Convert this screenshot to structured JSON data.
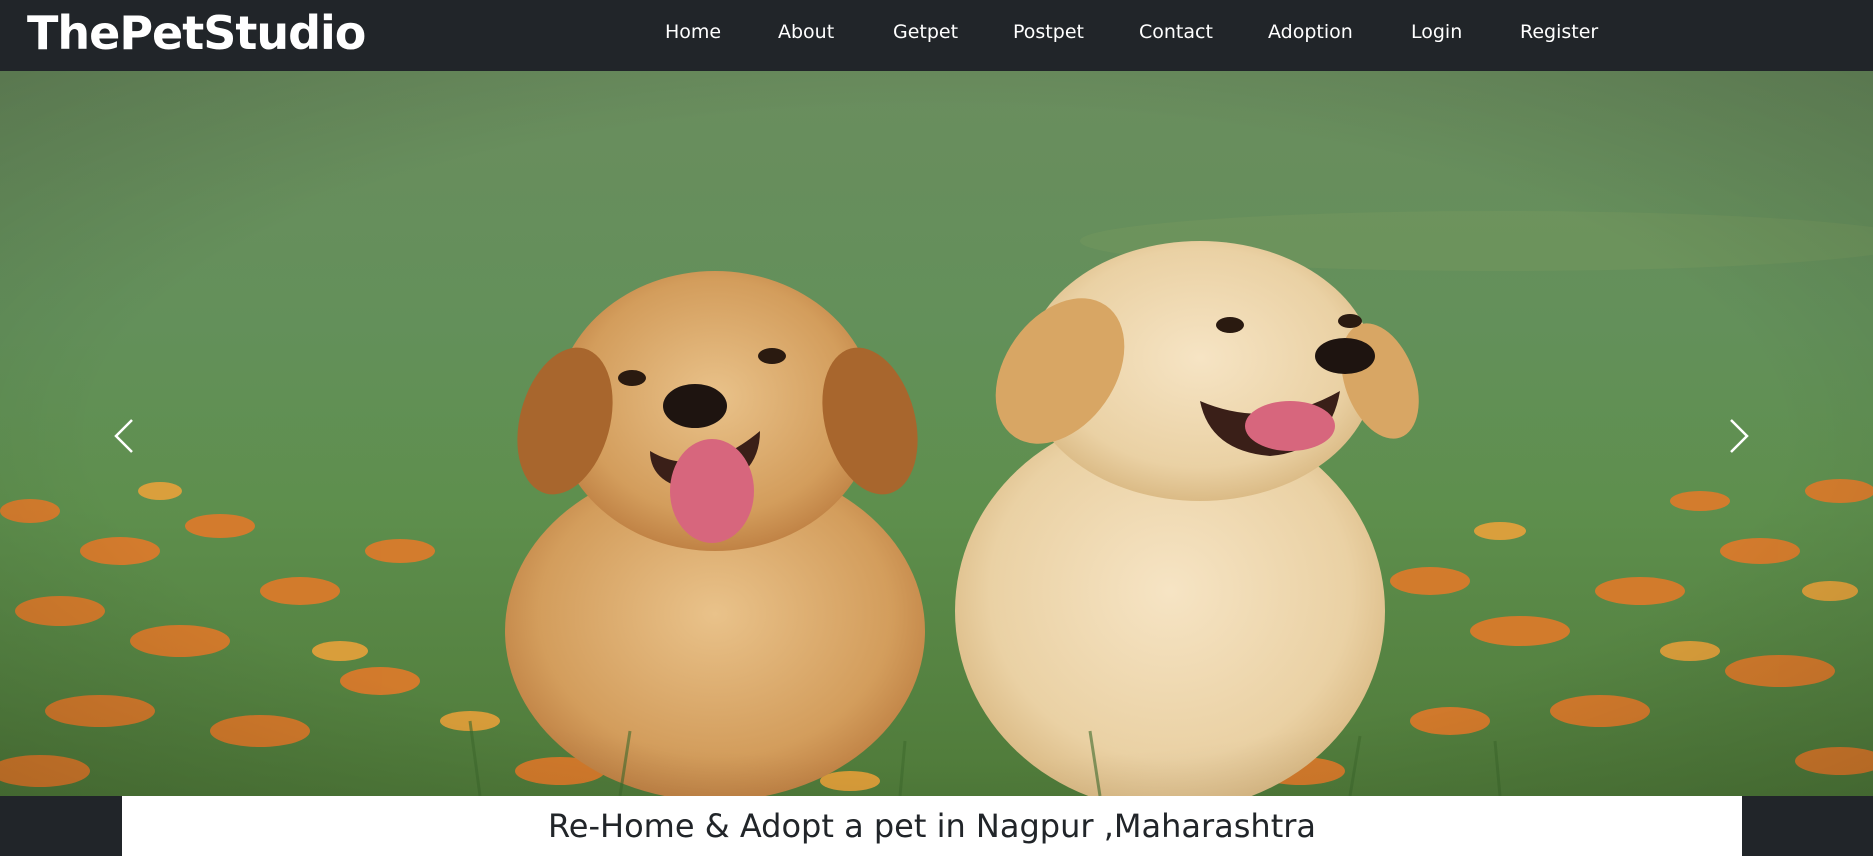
{
  "brand": "ThePetStudio",
  "nav": {
    "items": [
      {
        "label": "Home"
      },
      {
        "label": "About"
      },
      {
        "label": "Getpet"
      },
      {
        "label": "Postpet"
      },
      {
        "label": "Contact"
      },
      {
        "label": "Adoption"
      },
      {
        "label": "Login"
      },
      {
        "label": "Register"
      }
    ]
  },
  "carousel": {
    "prev_icon": "chevron-left-icon",
    "next_icon": "chevron-right-icon"
  },
  "caption": {
    "title": "Re-Home & Adopt a pet in Nagpur ,Maharashtra"
  },
  "colors": {
    "navbar_bg": "#212529",
    "nav_text": "#ffffff",
    "caption_bg": "#ffffff",
    "caption_text": "#212529"
  }
}
